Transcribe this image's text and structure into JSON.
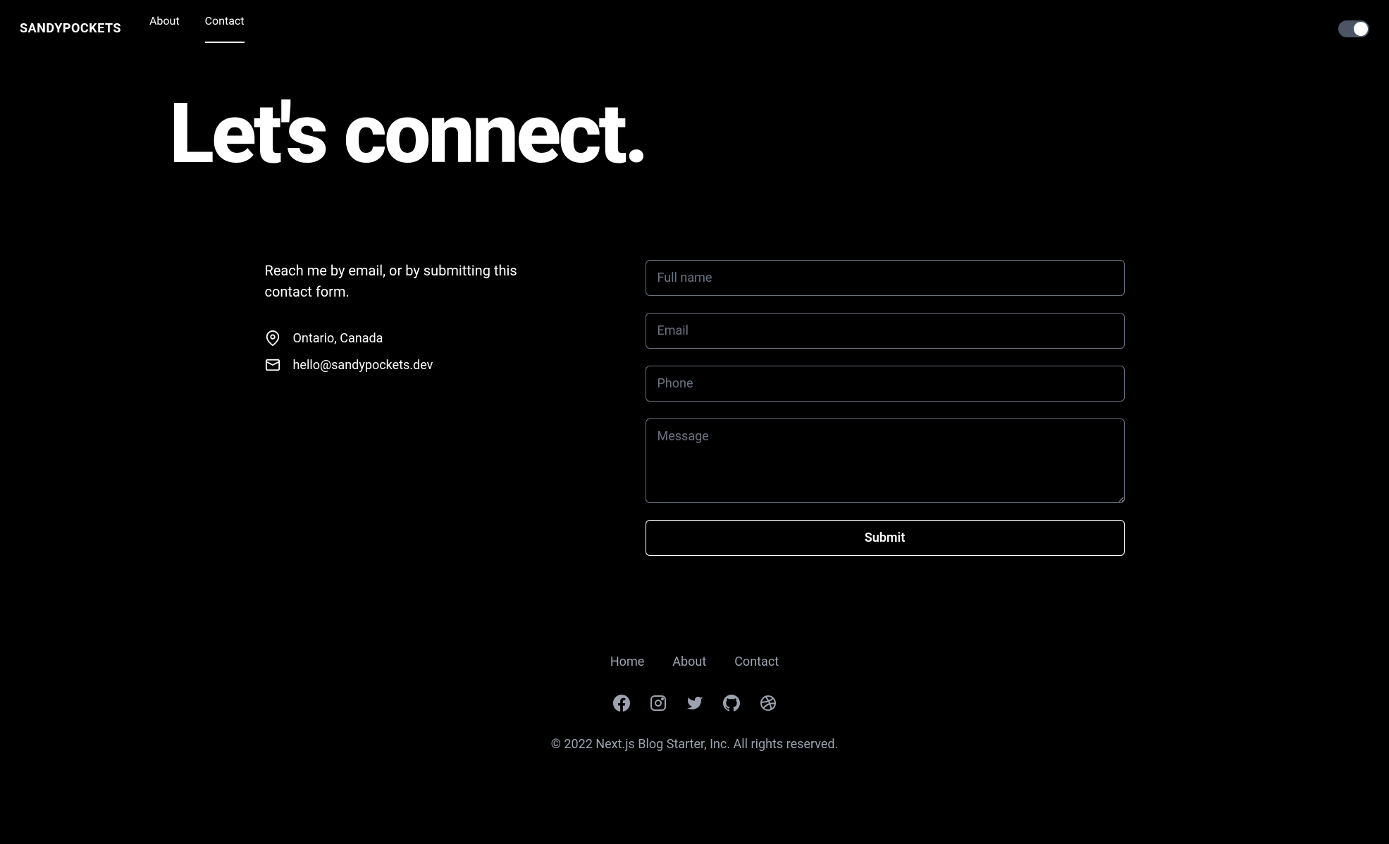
{
  "header": {
    "brand": "SANDYPOCKETS",
    "nav": [
      {
        "label": "About",
        "active": false
      },
      {
        "label": "Contact",
        "active": true
      }
    ]
  },
  "hero": {
    "title": "Let's connect."
  },
  "contact": {
    "intro": "Reach me by email, or by submitting this contact form.",
    "location": "Ontario, Canada",
    "email": "hello@sandypockets.dev"
  },
  "form": {
    "fullname_placeholder": "Full name",
    "email_placeholder": "Email",
    "phone_placeholder": "Phone",
    "message_placeholder": "Message",
    "submit_label": "Submit"
  },
  "footer": {
    "links": [
      {
        "label": "Home"
      },
      {
        "label": "About"
      },
      {
        "label": "Contact"
      }
    ],
    "copyright": "© 2022 Next.js Blog Starter, Inc. All rights reserved."
  }
}
